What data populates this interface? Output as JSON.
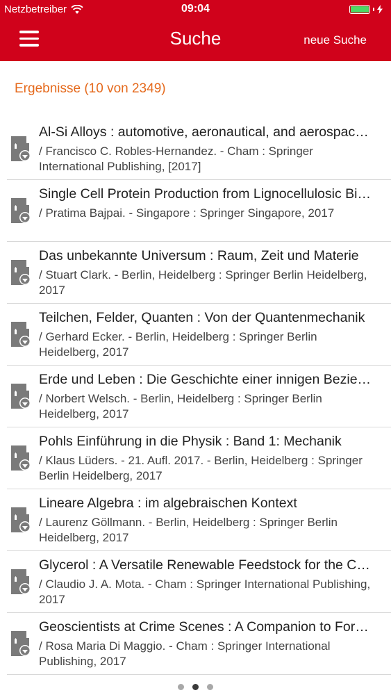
{
  "status": {
    "carrier": "Netzbetreiber",
    "time": "09:04",
    "battery_level": 1.0
  },
  "nav": {
    "title": "Suche",
    "new_search": "neue Suche",
    "menu_icon": "hamburger-icon"
  },
  "results": {
    "header": "Ergebnisse (10 von 2349)",
    "items": [
      {
        "title": "Al-Si Alloys : automotive, aeronautical, and aerospace applications",
        "meta": "/ Francisco C. Robles-Hernandez. - Cham : Springer International Publishing, [2017]"
      },
      {
        "title": "Single Cell Protein Production from Lignocellulosic Biomass",
        "meta": "/ Pratima Bajpai. - Singapore : Springer Singapore, 2017"
      },
      {
        "title": "Das unbekannte Universum : Raum, Zeit und Materie",
        "meta": "/ Stuart Clark. - Berlin, Heidelberg : Springer Berlin Heidelberg, 2017"
      },
      {
        "title": "Teilchen, Felder, Quanten : Von der Quantenmechanik",
        "meta": "/ Gerhard Ecker. - Berlin, Heidelberg : Springer Berlin Heidelberg, 2017"
      },
      {
        "title": "Erde und Leben : Die Geschichte einer innigen Beziehung",
        "meta": "/ Norbert Welsch. - Berlin, Heidelberg : Springer Berlin Heidelberg, 2017"
      },
      {
        "title": "Pohls Einführung in die Physik : Band 1: Mechanik",
        "meta": "/ Klaus Lüders. - 21. Aufl. 2017. - Berlin, Heidelberg : Springer Berlin Heidelberg, 2017"
      },
      {
        "title": "Lineare Algebra : im algebraischen Kontext",
        "meta": "/ Laurenz Göllmann. - Berlin, Heidelberg : Springer Berlin Heidelberg, 2017"
      },
      {
        "title": "Glycerol : A Versatile Renewable Feedstock for the Chemical Industry",
        "meta": "/ Claudio J. A. Mota. - Cham : Springer International Publishing, 2017"
      },
      {
        "title": "Geoscientists at Crime Scenes : A Companion to Forensic Geoscience",
        "meta": "/ Rosa Maria Di Maggio. - Cham : Springer International Publishing, 2017"
      }
    ]
  },
  "pager": {
    "pages": 3,
    "active": 1
  },
  "colors": {
    "brand": "#d0021b",
    "accent": "#e56a1d",
    "battery": "#4cd964"
  }
}
